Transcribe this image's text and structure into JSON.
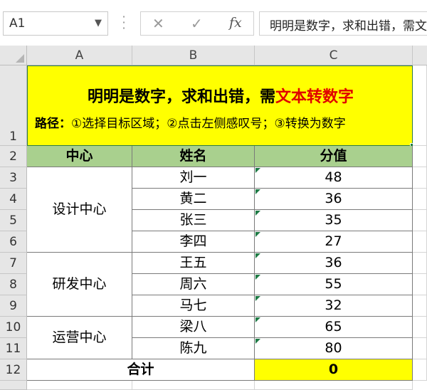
{
  "formula_bar": {
    "name_box": "A1",
    "name_box_arrow": "chevron-down-icon",
    "cancel_icon": "✕",
    "enter_icon": "✓",
    "fx_label": "fx",
    "content": "明明是数字，求和出错，需文本转数字"
  },
  "columns": [
    "A",
    "B",
    "C"
  ],
  "rows": [
    "1",
    "2",
    "3",
    "4",
    "5",
    "6",
    "7",
    "8",
    "9",
    "10",
    "11",
    "12"
  ],
  "title": {
    "line1_black": "明明是数字，求和出错，需",
    "line1_red": "文本转数字",
    "line2_label": "路径：",
    "line2_text": "①选择目标区域；②点击左侧感叹号；③转换为数字",
    "fill_color": "#ffff00",
    "red_color": "#e00000"
  },
  "table": {
    "headers": [
      "中心",
      "姓名",
      "分值"
    ],
    "header_fill": "#a9d08e",
    "groups": [
      "设计中心",
      "研发中心",
      "运营中心"
    ],
    "names": [
      "刘一",
      "黄二",
      "张三",
      "李四",
      "王五",
      "周六",
      "马七",
      "梁八",
      "陈九"
    ],
    "values": [
      "48",
      "36",
      "35",
      "27",
      "36",
      "55",
      "32",
      "65",
      "80"
    ],
    "total_label": "合计",
    "total_value": "0",
    "total_fill": "#ffff00"
  }
}
